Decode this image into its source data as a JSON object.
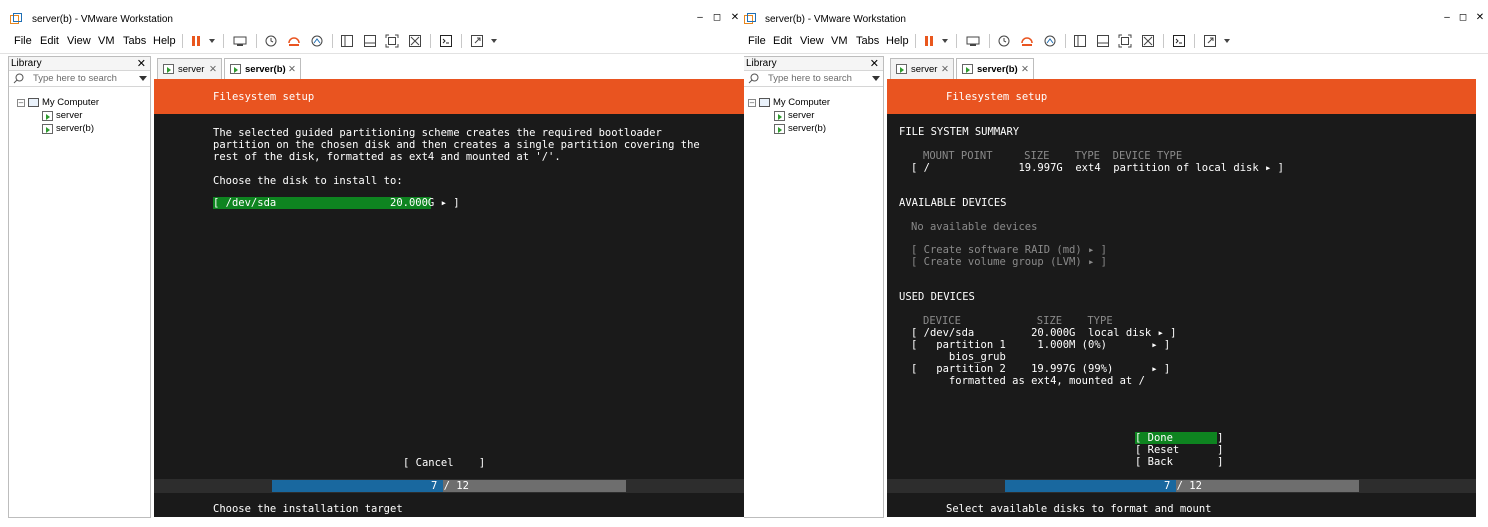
{
  "colors": {
    "ubuntu_orange": "#e95420",
    "console_bg": "#1a1a1a",
    "selected_green": "#0e8420",
    "progress_blue": "#19689f"
  },
  "left": {
    "window_title": "server(b) - VMware Workstation",
    "menus": [
      "File",
      "Edit",
      "View",
      "VM",
      "Tabs",
      "Help"
    ],
    "library": {
      "title": "Library",
      "search_placeholder": "Type here to search",
      "root": "My Computer",
      "vms": [
        "server",
        "server(b)"
      ]
    },
    "tabs": [
      "server",
      "server(b)"
    ],
    "active_tab": "server(b)",
    "console": {
      "header": "Filesystem setup",
      "body_lines": [
        "The selected guided partitioning scheme creates the required bootloader",
        "partition on the chosen disk and then creates a single partition covering the",
        "rest of the disk, formatted as ext4 and mounted at '/'."
      ],
      "choose_label": "Choose the disk to install to:",
      "disk_option": "[ /dev/sda                  20.000G ▸ ]",
      "cancel_button": "[ Cancel    ]",
      "progress": {
        "text": "7 / 12",
        "step": 7,
        "total": 12
      },
      "footer": "Choose the installation target"
    }
  },
  "right": {
    "window_title": "server(b) - VMware Workstation",
    "menus": [
      "File",
      "Edit",
      "View",
      "VM",
      "Tabs",
      "Help"
    ],
    "library": {
      "title": "Library",
      "search_placeholder": "Type here to search",
      "root": "My Computer",
      "vms": [
        "server",
        "server(b)"
      ]
    },
    "tabs": [
      "server",
      "server(b)"
    ],
    "active_tab": "server(b)",
    "console": {
      "header": "Filesystem setup",
      "fs_summary_title": "FILE SYSTEM SUMMARY",
      "fs_summary_header": "MOUNT POINT     SIZE    TYPE  DEVICE TYPE",
      "fs_summary_row": "[ /              19.997G  ext4  partition of local disk ▸ ]",
      "available_title": "AVAILABLE DEVICES",
      "no_devices": "No available devices",
      "create_raid": "[ Create software RAID (md) ▸ ]",
      "create_lvm": "[ Create volume group (LVM) ▸ ]",
      "used_title": "USED DEVICES",
      "used_header": "DEVICE            SIZE    TYPE",
      "used_rows": [
        "[ /dev/sda         20.000G  local disk ▸ ]",
        "[   partition 1     1.000M (0%)       ▸ ]",
        "      bios_grub",
        "[   partition 2    19.997G (99%)      ▸ ]",
        "      formatted as ext4, mounted at /"
      ],
      "done_button": "[ Done       ]",
      "reset_button": "[ Reset      ]",
      "back_button": "[ Back       ]",
      "progress": {
        "text": "7 / 12",
        "step": 7,
        "total": 12
      },
      "footer": "Select available disks to format and mount"
    }
  }
}
